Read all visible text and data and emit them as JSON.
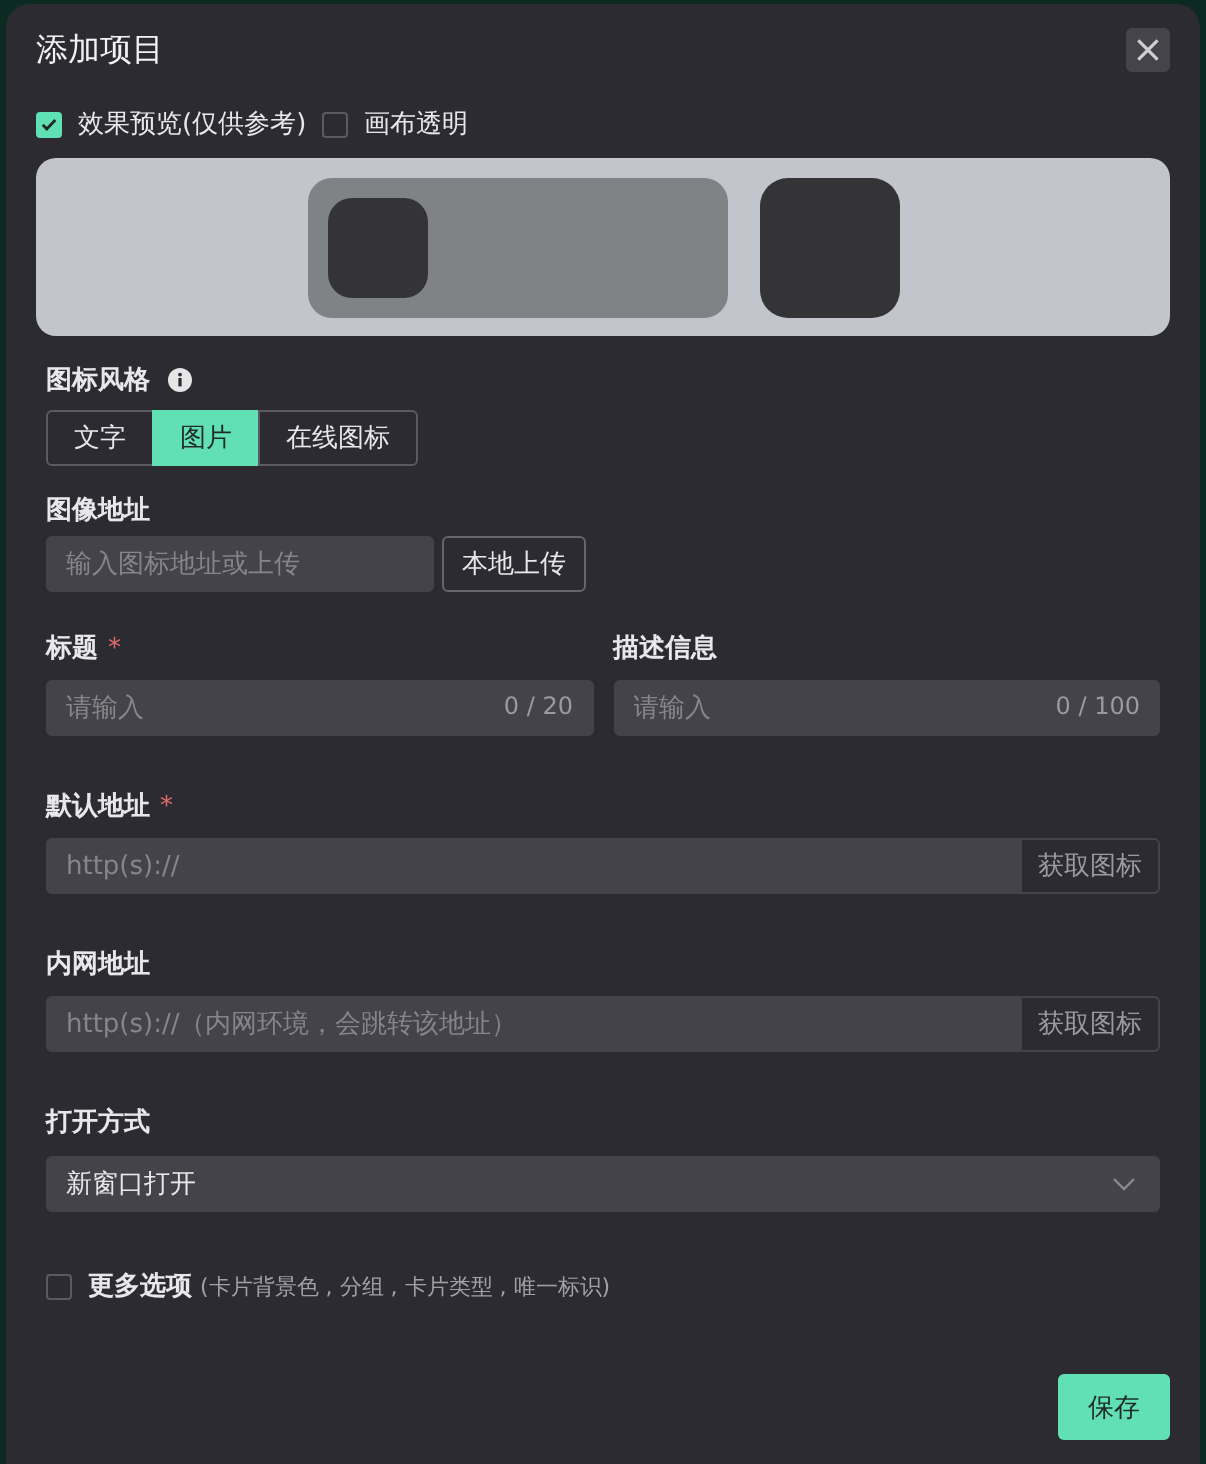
{
  "dialog": {
    "title": "添加项目",
    "close_label": "×"
  },
  "preview_options": [
    {
      "label": "效果预览(仅供参考)",
      "checked": true
    },
    {
      "label": "画布透明",
      "checked": false
    }
  ],
  "icon_style": {
    "label": "图标风格",
    "tabs": [
      {
        "label": "文字",
        "selected": false
      },
      {
        "label": "图片",
        "selected": true
      },
      {
        "label": "在线图标",
        "selected": false
      }
    ]
  },
  "image_url": {
    "label": "图像地址",
    "placeholder": "输入图标地址或上传",
    "button": "本地上传"
  },
  "title_field": {
    "label": "标题",
    "required_mark": "*",
    "placeholder": "请输入",
    "counter": "0 / 20"
  },
  "description_field": {
    "label": "描述信息",
    "placeholder": "请输入",
    "counter": "0 / 100"
  },
  "default_url": {
    "label": "默认地址",
    "required_mark": "*",
    "placeholder": "http(s)://",
    "button": "获取图标"
  },
  "intranet_url": {
    "label": "内网地址",
    "placeholder": "http(s)://（内网环境，会跳转该地址）",
    "button": "获取图标"
  },
  "open_mode": {
    "label": "打开方式",
    "value": "新窗口打开"
  },
  "more_options": {
    "label": "更多选项",
    "hint": "(卡片背景色 , 分组 , 卡片类型 , 唯一标识)",
    "checked": false
  },
  "save_button": "保存"
}
